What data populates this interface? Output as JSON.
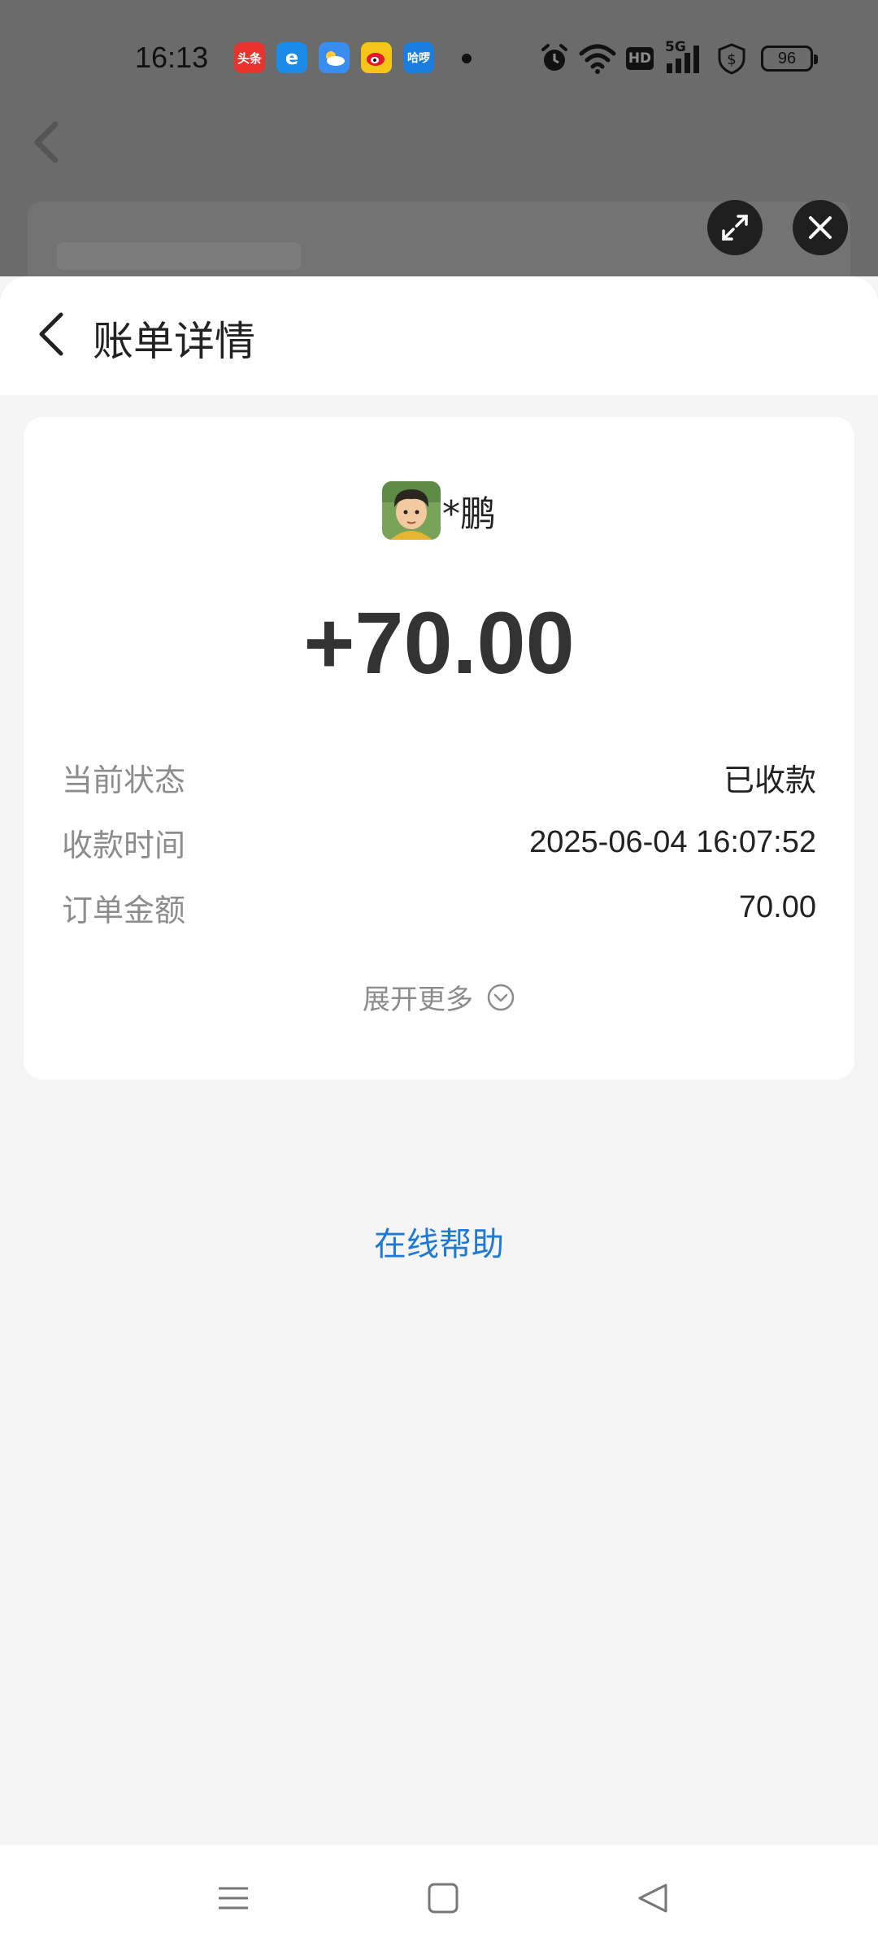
{
  "status_bar": {
    "time": "16:13",
    "apps": [
      {
        "name": "toutiao-app-icon",
        "label": "头条",
        "color": "#e8322e"
      },
      {
        "name": "browser-app-icon",
        "label": "e",
        "color": "#1a8be8"
      },
      {
        "name": "weather-app-icon",
        "label": "",
        "color": "#3a8df0"
      },
      {
        "name": "weibo-app-icon",
        "label": "",
        "color": "#f5c518"
      },
      {
        "name": "hellobike-app-icon",
        "label": "哈啰",
        "color": "#1a7de0"
      }
    ],
    "hd_label": "HD",
    "network_label": "5G",
    "battery": "96"
  },
  "sheet": {
    "title": "账单详情"
  },
  "bill": {
    "payer_name": "*鹏",
    "amount": "+70.00",
    "rows": [
      {
        "label": "当前状态",
        "value": "已收款"
      },
      {
        "label": "收款时间",
        "value": "2025-06-04 16:07:52"
      },
      {
        "label": "订单金额",
        "value": "70.00"
      }
    ],
    "expand_label": "展开更多"
  },
  "help_link": "在线帮助",
  "colors": {
    "accent_link": "#1e78d6",
    "backdrop": "#6b6b6b",
    "page_bg": "#f5f5f5"
  }
}
